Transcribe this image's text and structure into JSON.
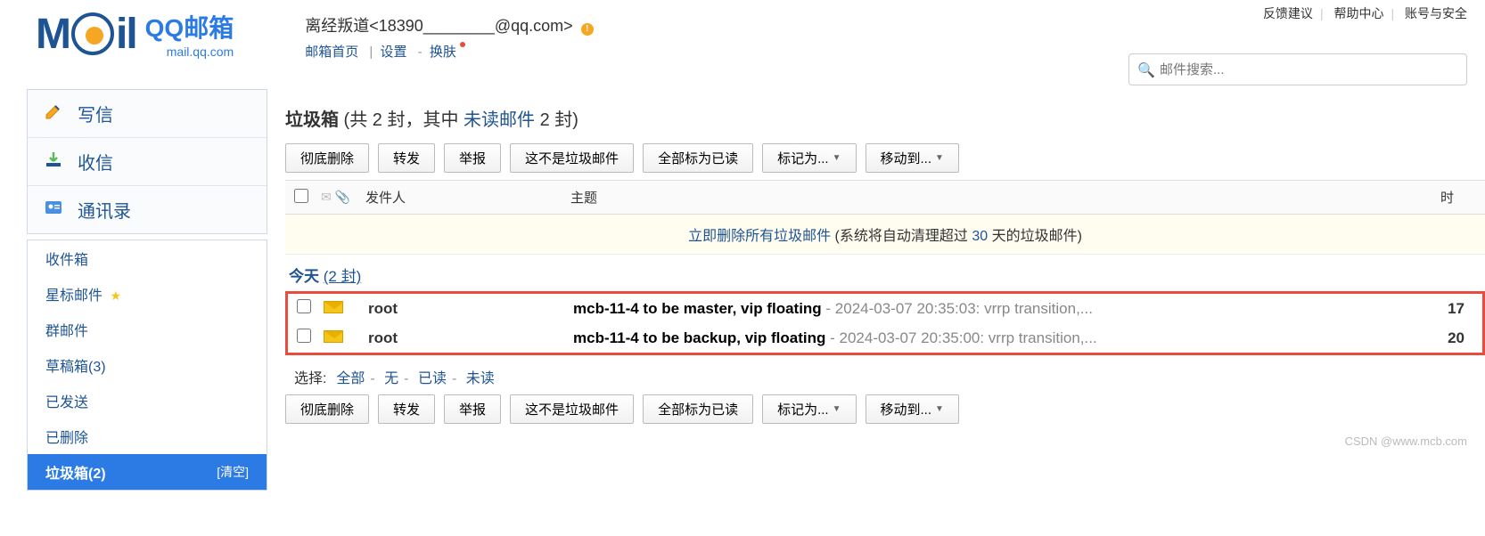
{
  "logo": {
    "left": "M",
    "right": "il",
    "cn_top": "QQ邮箱",
    "cn_bot": "mail.qq.com"
  },
  "user": {
    "display": "离经叛道<18390________@qq.com>",
    "links": {
      "home": "邮箱首页",
      "settings": "设置",
      "skin": "换肤"
    }
  },
  "top_right": {
    "feedback": "反馈建议",
    "help": "帮助中心",
    "account": "账号与安全"
  },
  "search": {
    "placeholder": "邮件搜索..."
  },
  "side_main": {
    "compose": "写信",
    "inbox": "收信",
    "contacts": "通讯录"
  },
  "side_list": {
    "inbox": "收件箱",
    "starred": "星标邮件",
    "group": "群邮件",
    "drafts": "草稿箱(3)",
    "sent": "已发送",
    "deleted": "已删除",
    "spam": "垃圾箱(2)",
    "clear": "[清空]"
  },
  "folder": {
    "name": "垃圾箱",
    "summary_pre": " (共 2 封，其中 ",
    "unread_label": "未读邮件",
    "summary_post": " 2 封)"
  },
  "toolbar": {
    "perm_delete": "彻底删除",
    "forward": "转发",
    "report": "举报",
    "not_spam": "这不是垃圾邮件",
    "mark_all_read": "全部标为已读",
    "mark_as": "标记为...",
    "move_to": "移动到..."
  },
  "columns": {
    "sender": "发件人",
    "subject": "主题",
    "time": "时"
  },
  "notice": {
    "delete_all": "立即删除所有垃圾邮件",
    "pre": " (系统将自动清理超过 ",
    "days": "30",
    "post": " 天的垃圾邮件)"
  },
  "group": {
    "label": "今天",
    "count": "(2 封)"
  },
  "mails": [
    {
      "sender": "root",
      "subject": "mcb-11-4 to be master, vip floating",
      "preview": " - 2024-03-07 20:35:03: vrrp transition,...",
      "time": "17"
    },
    {
      "sender": "root",
      "subject": "mcb-11-4 to be backup, vip floating",
      "preview": " - 2024-03-07 20:35:00: vrrp transition,...",
      "time": "20"
    }
  ],
  "select": {
    "label": "选择:",
    "all": "全部",
    "none": "无",
    "read": "已读",
    "unread": "未读"
  },
  "watermark": "CSDN @www.mcb.com"
}
